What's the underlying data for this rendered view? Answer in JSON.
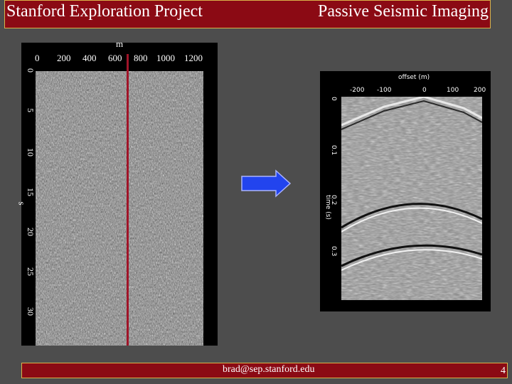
{
  "header": {
    "left_title": "Stanford Exploration Project",
    "right_title": "Passive Seismic Imaging"
  },
  "footer": {
    "email": "brad@sep.stanford.edu",
    "page_number": "4"
  },
  "left_plot": {
    "x_unit": "m",
    "x_ticks": [
      "0",
      "200",
      "400",
      "600",
      "800",
      "1000",
      "1200"
    ],
    "y_unit": "s",
    "y_ticks": [
      "0",
      "5",
      "10",
      "15",
      "20",
      "25",
      "30"
    ]
  },
  "right_plot": {
    "x_label": "offset (m)",
    "x_ticks": [
      "-200",
      "-100",
      "0",
      "100",
      "200"
    ],
    "y_label": "time (s)",
    "y_ticks": [
      "0",
      "0.1",
      "0.2",
      "0.3"
    ]
  },
  "colors": {
    "title_bar": "#8b0a14",
    "border": "#d9b24a",
    "marker_line": "#a01428",
    "arrow": "#2244ee"
  }
}
